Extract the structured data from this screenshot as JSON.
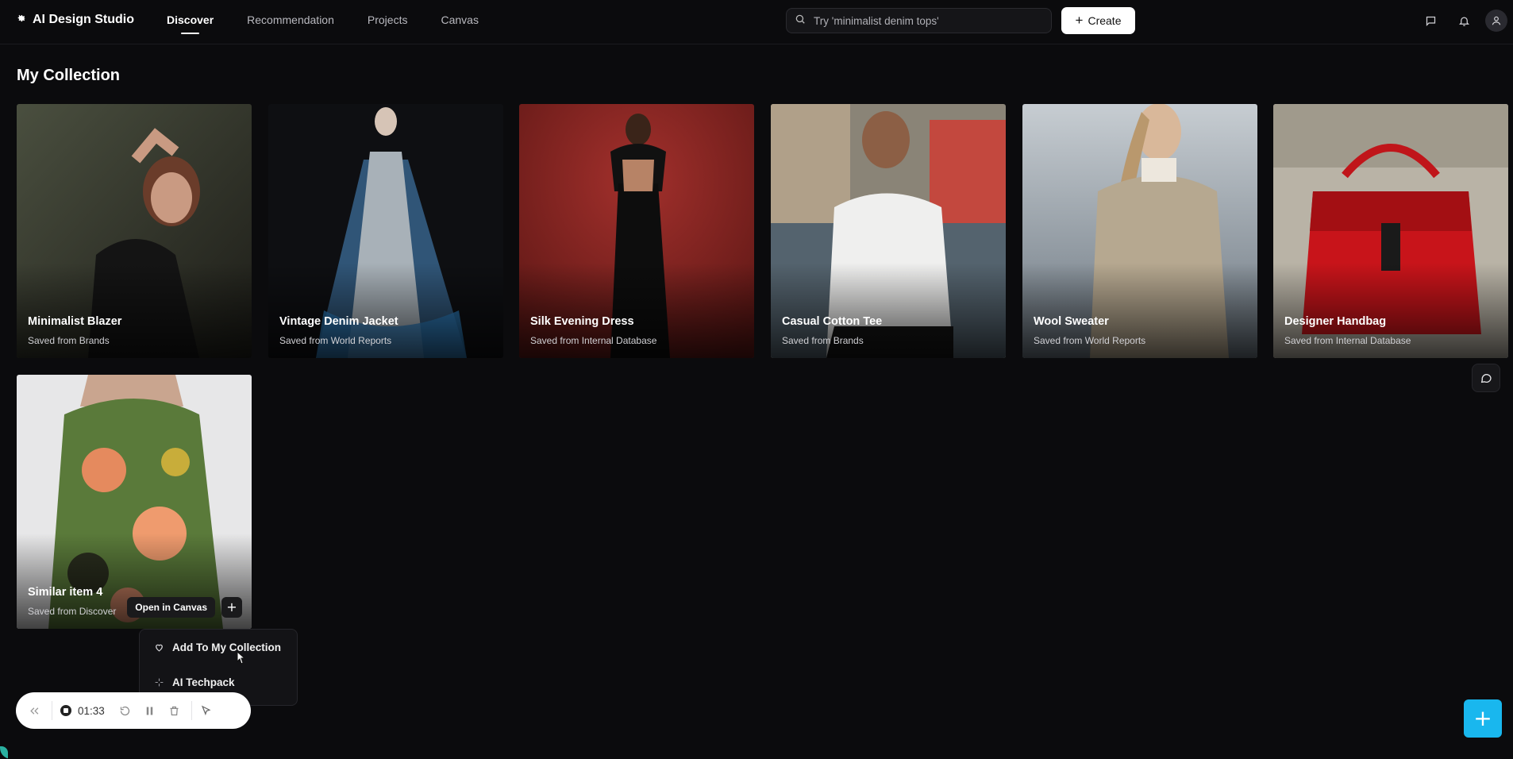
{
  "app": {
    "title": "AI Design Studio"
  },
  "nav": [
    {
      "label": "Discover",
      "active": true
    },
    {
      "label": "Recommendation",
      "active": false
    },
    {
      "label": "Projects",
      "active": false
    },
    {
      "label": "Canvas",
      "active": false
    }
  ],
  "search": {
    "placeholder": "Try 'minimalist denim tops'",
    "value": ""
  },
  "header": {
    "create_label": "Create"
  },
  "page": {
    "title": "My Collection"
  },
  "cards": [
    {
      "title": "Minimalist Blazer",
      "source": "Saved from Brands"
    },
    {
      "title": "Vintage Denim Jacket",
      "source": "Saved from World Reports"
    },
    {
      "title": "Silk Evening Dress",
      "source": "Saved from Internal Database"
    },
    {
      "title": "Casual Cotton Tee",
      "source": "Saved from Brands"
    },
    {
      "title": "Wool Sweater",
      "source": "Saved from World Reports"
    },
    {
      "title": "Designer Handbag",
      "source": "Saved from Internal Database"
    },
    {
      "title": "Similar item 4",
      "source": "Saved from Discover"
    }
  ],
  "card_actions": {
    "open_canvas_label": "Open in Canvas",
    "plus_label": "+"
  },
  "menu": {
    "items": [
      {
        "label": "Add To My Collection"
      },
      {
        "label": "AI Techpack"
      }
    ]
  },
  "recorder": {
    "time": "01:33"
  },
  "fab": {
    "label": "+"
  },
  "colors": {
    "accent": "#19b7ee",
    "background": "#0b0b0d"
  }
}
